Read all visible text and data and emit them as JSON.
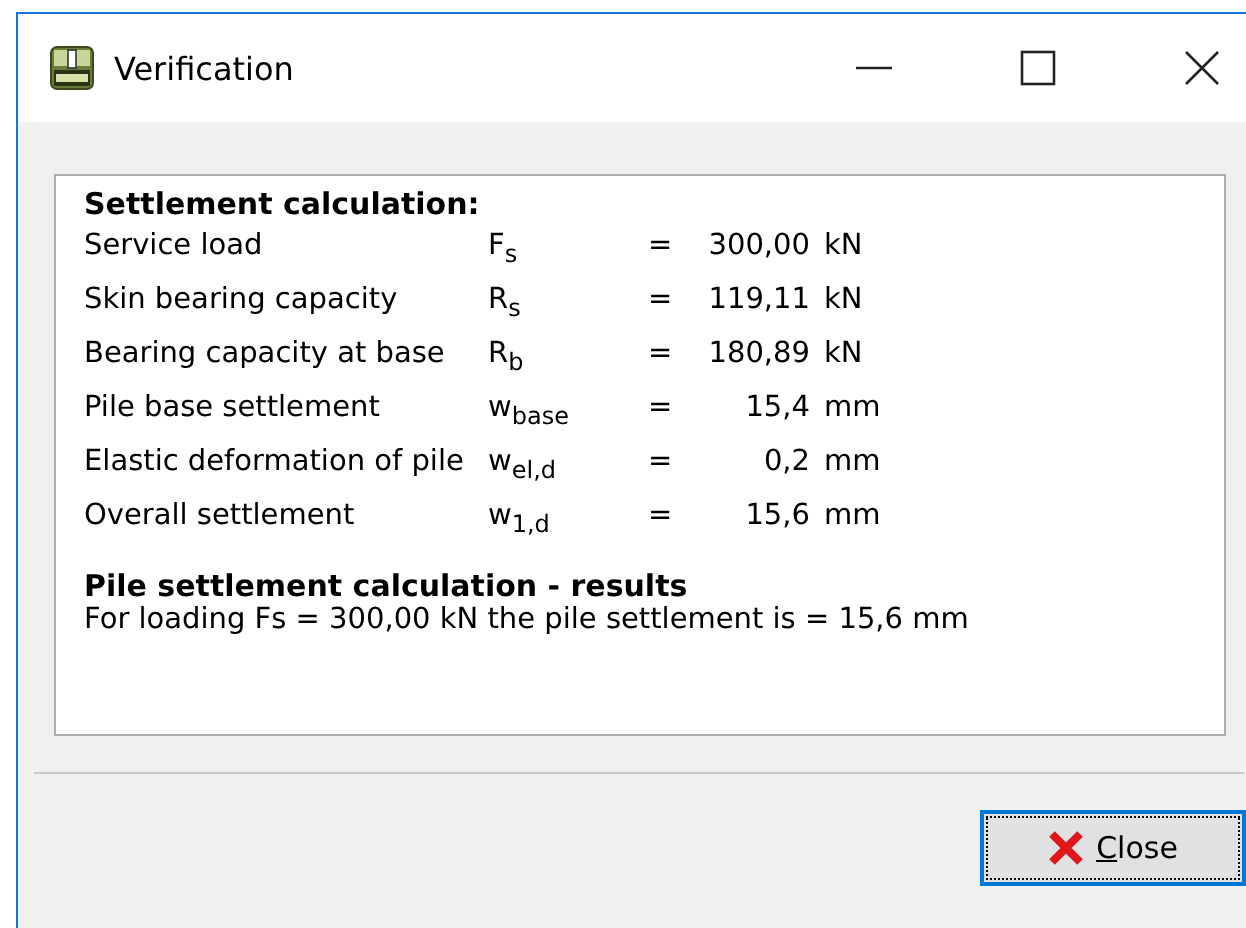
{
  "window": {
    "title": "Verification"
  },
  "settlement": {
    "heading": "Settlement calculation:",
    "rows": [
      {
        "label": "Service load",
        "symbol": "F$_{s}$",
        "equals": "=",
        "value": "300,00",
        "unit": "kN"
      },
      {
        "label": "Skin bearing capacity",
        "symbol": "R$_{s}$",
        "equals": "=",
        "value": "119,11",
        "unit": "kN"
      },
      {
        "label": "Bearing capacity at base",
        "symbol": "R$_{b}$",
        "equals": "=",
        "value": "180,89",
        "unit": "kN"
      },
      {
        "label": "Pile base settlement",
        "symbol": "w$_{base}$",
        "equals": "=",
        "value": "15,4",
        "unit": "mm"
      },
      {
        "label": "Elastic deformation of pile",
        "symbol": "w$_{el,d}$",
        "equals": "=",
        "value": "0,2",
        "unit": "mm"
      },
      {
        "label": "Overall settlement",
        "symbol": "w$_{1,d}$",
        "equals": "=",
        "value": "15,6",
        "unit": "mm"
      }
    ]
  },
  "results": {
    "heading": "Pile settlement calculation - results",
    "text": "For loading Fs = 300,00 kN the pile settlement is = 15,6 mm"
  },
  "buttons": [
    {
      "label": "Close",
      "kind": "close"
    }
  ]
}
